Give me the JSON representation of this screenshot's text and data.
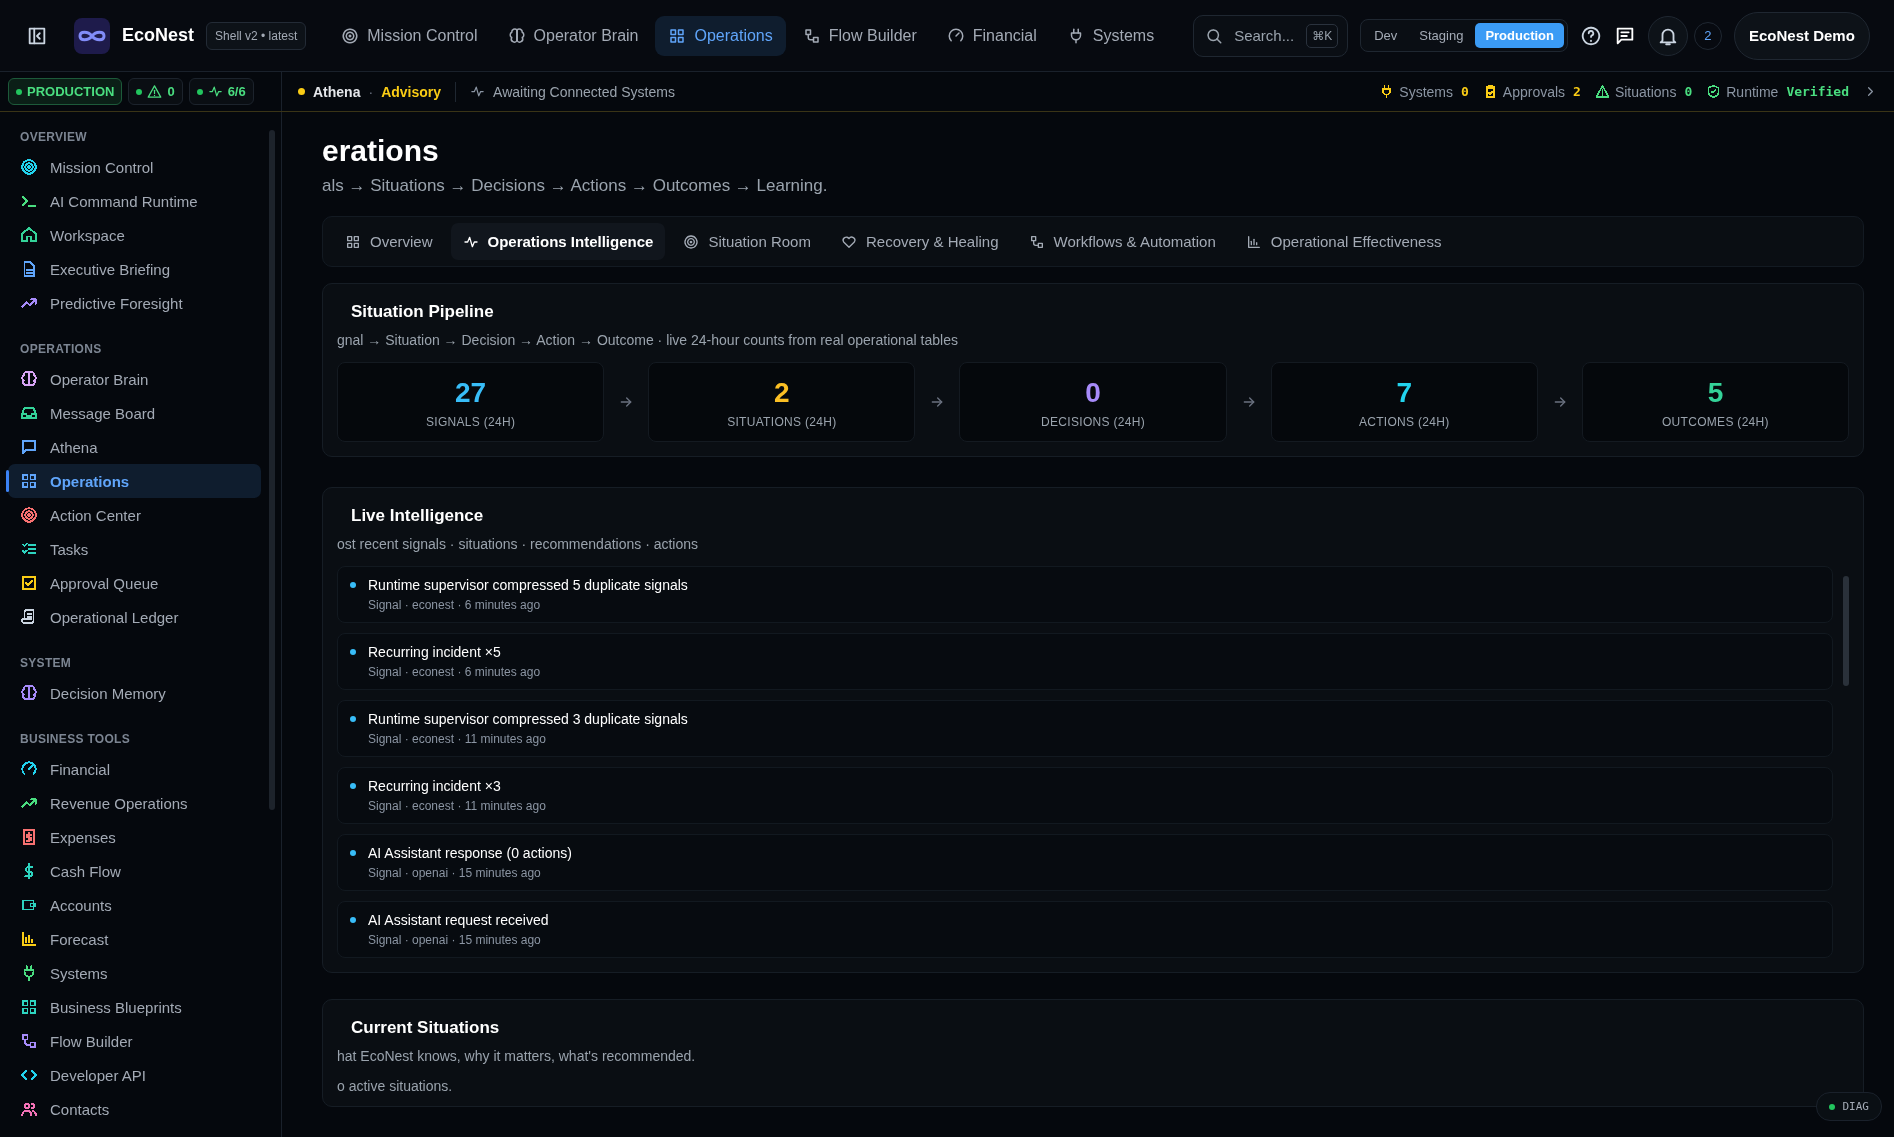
{
  "brand": {
    "name": "EcoNest",
    "version": "Shell v2 • latest"
  },
  "top_nav": [
    {
      "label": "Mission Control",
      "selected": false
    },
    {
      "label": "Operator Brain",
      "selected": false
    },
    {
      "label": "Operations",
      "selected": true
    },
    {
      "label": "Flow Builder",
      "selected": false
    },
    {
      "label": "Financial",
      "selected": false
    },
    {
      "label": "Systems",
      "selected": false
    }
  ],
  "search": {
    "placeholder": "Search...",
    "shortcut": "⌘K"
  },
  "environments": [
    {
      "label": "Dev",
      "selected": false
    },
    {
      "label": "Staging",
      "selected": false
    },
    {
      "label": "Production",
      "selected": true
    }
  ],
  "notifications": {
    "count": "2"
  },
  "user": {
    "name": "EcoNest Demo"
  },
  "status": {
    "environment": "PRODUCTION",
    "alerts": "0",
    "health": "6/6"
  },
  "assistant": {
    "name": "Athena",
    "separator": "·",
    "mode": "Advisory",
    "activity": "Awaiting Connected Systems"
  },
  "indicators": [
    {
      "label": "Systems",
      "value": "0",
      "color": "#facc15"
    },
    {
      "label": "Approvals",
      "value": "2",
      "color": "#facc15"
    },
    {
      "label": "Situations",
      "value": "0",
      "color": "#4ade80"
    },
    {
      "label": "Runtime",
      "value": "Verified",
      "color": "#4ade80"
    }
  ],
  "sidebar": {
    "sections": [
      {
        "title": "OVERVIEW",
        "items": [
          {
            "label": "Mission Control",
            "color": "#22d3ee",
            "selected": false
          },
          {
            "label": "AI Command Runtime",
            "color": "#4ade80",
            "selected": false
          },
          {
            "label": "Workspace",
            "color": "#34d399",
            "selected": false
          },
          {
            "label": "Executive Briefing",
            "color": "#60a5fa",
            "selected": false
          },
          {
            "label": "Predictive Foresight",
            "color": "#a78bfa",
            "selected": false
          }
        ]
      },
      {
        "title": "OPERATIONS",
        "items": [
          {
            "label": "Operator Brain",
            "color": "#d8a4f5",
            "selected": false
          },
          {
            "label": "Message Board",
            "color": "#34d399",
            "selected": false
          },
          {
            "label": "Athena",
            "color": "#60a5fa",
            "selected": false
          },
          {
            "label": "Operations",
            "color": "#60a5fa",
            "selected": true
          },
          {
            "label": "Action Center",
            "color": "#f87171",
            "selected": false
          },
          {
            "label": "Tasks",
            "color": "#2dd4bf",
            "selected": false
          },
          {
            "label": "Approval Queue",
            "color": "#facc15",
            "selected": false
          },
          {
            "label": "Operational Ledger",
            "color": "#cbd5e1",
            "selected": false
          }
        ]
      },
      {
        "title": "SYSTEM",
        "items": [
          {
            "label": "Decision Memory",
            "color": "#a78bfa",
            "selected": false
          }
        ]
      },
      {
        "title": "BUSINESS TOOLS",
        "items": [
          {
            "label": "Financial",
            "color": "#22d3ee",
            "selected": false
          },
          {
            "label": "Revenue Operations",
            "color": "#4ade80",
            "selected": false
          },
          {
            "label": "Expenses",
            "color": "#f87171",
            "selected": false
          },
          {
            "label": "Cash Flow",
            "color": "#2dd4bf",
            "selected": false
          },
          {
            "label": "Accounts",
            "color": "#2dd4bf",
            "selected": false
          },
          {
            "label": "Forecast",
            "color": "#facc15",
            "selected": false
          },
          {
            "label": "Systems",
            "color": "#4ade80",
            "selected": false
          },
          {
            "label": "Business Blueprints",
            "color": "#2dd4bf",
            "selected": false
          },
          {
            "label": "Flow Builder",
            "color": "#a78bfa",
            "selected": false
          },
          {
            "label": "Developer API",
            "color": "#22d3ee",
            "selected": false
          },
          {
            "label": "Contacts",
            "color": "#f472b6",
            "selected": false
          }
        ]
      }
    ]
  },
  "page": {
    "title": "erations",
    "subtitle": "als → Situations → Decisions → Actions → Outcomes → Learning."
  },
  "tabs": [
    {
      "label": "Overview",
      "selected": false
    },
    {
      "label": "Operations Intelligence",
      "selected": true
    },
    {
      "label": "Situation Room",
      "selected": false
    },
    {
      "label": "Recovery & Healing",
      "selected": false
    },
    {
      "label": "Workflows & Automation",
      "selected": false
    },
    {
      "label": "Operational Effectiveness",
      "selected": false
    }
  ],
  "pipeline": {
    "title": "Situation Pipeline",
    "subtitle": "gnal → Situation → Decision → Action → Outcome · live 24-hour counts from real operational tables",
    "stages": [
      {
        "value": "27",
        "label": "SIGNALS (24H)",
        "color": "#38bdf8"
      },
      {
        "value": "2",
        "label": "SITUATIONS (24H)",
        "color": "#fbbf24"
      },
      {
        "value": "0",
        "label": "DECISIONS (24H)",
        "color": "#a78bfa"
      },
      {
        "value": "7",
        "label": "ACTIONS (24H)",
        "color": "#22d3ee"
      },
      {
        "value": "5",
        "label": "OUTCOMES (24H)",
        "color": "#34d399"
      }
    ]
  },
  "live": {
    "title": "Live Intelligence",
    "subtitle": "ost recent signals · situations · recommendations · actions",
    "items": [
      {
        "title": "Runtime supervisor compressed 5 duplicate signals",
        "meta": "Signal · econest · 6 minutes ago"
      },
      {
        "title": "Recurring incident ×5",
        "meta": "Signal · econest · 6 minutes ago"
      },
      {
        "title": "Runtime supervisor compressed 3 duplicate signals",
        "meta": "Signal · econest · 11 minutes ago"
      },
      {
        "title": "Recurring incident ×3",
        "meta": "Signal · econest · 11 minutes ago"
      },
      {
        "title": "AI Assistant response (0 actions)",
        "meta": "Signal · openai · 15 minutes ago"
      },
      {
        "title": "AI Assistant request received",
        "meta": "Signal · openai · 15 minutes ago"
      }
    ]
  },
  "situations": {
    "title": "Current Situations",
    "subtitle": "hat EcoNest knows, why it matters, what's recommended.",
    "empty": "o active situations."
  },
  "diag": {
    "label": "DIAG"
  }
}
